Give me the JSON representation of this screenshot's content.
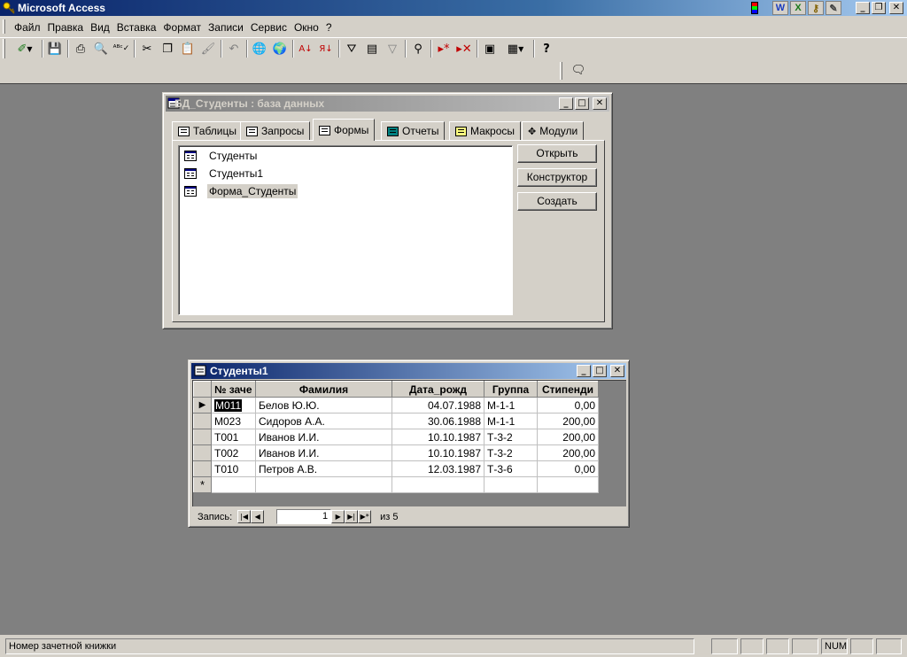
{
  "app": {
    "title": "Microsoft Access"
  },
  "menu": [
    "Файл",
    "Правка",
    "Вид",
    "Вставка",
    "Формат",
    "Записи",
    "Сервис",
    "Окно",
    "?"
  ],
  "db_window": {
    "title": "БД_Студенты : база данных",
    "tabs": [
      "Таблицы",
      "Запросы",
      "Формы",
      "Отчеты",
      "Макросы",
      "Модули"
    ],
    "active_tab": "Формы",
    "objects": [
      "Студенты",
      "Студенты1",
      "Форма_Студенты"
    ],
    "selected_object": "Форма_Студенты",
    "buttons": {
      "open": "Открыть",
      "design": "Конструктор",
      "create": "Создать"
    }
  },
  "datasheet": {
    "title": "Студенты1",
    "columns": [
      "№ заче",
      "Фамилия",
      "Дата_рожд",
      "Группа",
      "Стипенди"
    ],
    "rows": [
      [
        "М011",
        "Белов Ю.Ю.",
        "04.07.1988",
        "М-1-1",
        "0,00"
      ],
      [
        "М023",
        "Сидоров А.А.",
        "30.06.1988",
        "М-1-1",
        "200,00"
      ],
      [
        "Т001",
        "Иванов И.И.",
        "10.10.1987",
        "Т-3-2",
        "200,00"
      ],
      [
        "Т002",
        "Иванов И.И.",
        "10.10.1987",
        "Т-3-2",
        "200,00"
      ],
      [
        "Т010",
        "Петров А.В.",
        "12.03.1987",
        "Т-3-6",
        "0,00"
      ]
    ],
    "current_row_marker": "▶",
    "new_row_marker": "*",
    "nav": {
      "label": "Запись:",
      "current": "1",
      "of_text": "из  5"
    }
  },
  "statusbar": {
    "text": "Номер зачетной книжки",
    "num_indicator": "NUM"
  },
  "colors": {
    "title_active": "#0a246a",
    "title_inactive": "#808080",
    "workspace": "#808080",
    "face": "#d4d0c8"
  }
}
